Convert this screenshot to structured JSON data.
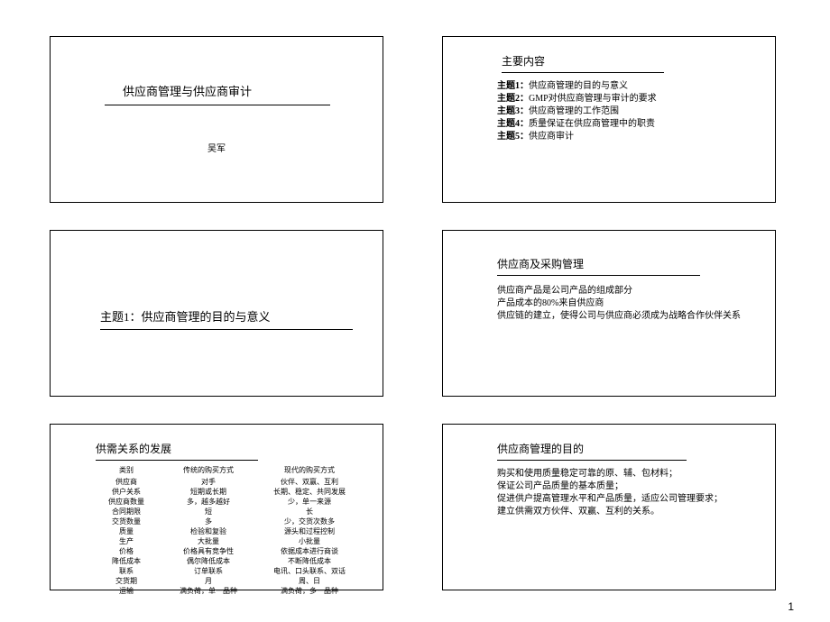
{
  "page_number": "1",
  "slide1": {
    "title": "供应商管理与供应商审计",
    "author": "吴军"
  },
  "slide2": {
    "title": "主要内容",
    "items": [
      {
        "prefix": "主题1：",
        "text": "供应商管理的目的与意义"
      },
      {
        "prefix": "主题2：",
        "text": "GMP对供应商管理与审计的要求"
      },
      {
        "prefix": "主题3：",
        "text": "供应商管理的工作范围"
      },
      {
        "prefix": "主题4：",
        "text": "质量保证在供应商管理中的职责"
      },
      {
        "prefix": "主题5：",
        "text": "供应商审计"
      }
    ]
  },
  "slide3": {
    "title": "主题1：供应商管理的目的与意义"
  },
  "slide4": {
    "title": "供应商及采购管理",
    "lines": [
      "供应商产品是公司产品的组成部分",
      "产品成本的80%来自供应商",
      "供应链的建立，使得公司与供应商必须成为战略合作伙伴关系"
    ]
  },
  "slide5": {
    "title": "供需关系的发展",
    "headers": [
      "类别",
      "传统的购买方式",
      "现代的购买方式"
    ],
    "rows": [
      [
        "供应商",
        "对手",
        "伙伴、双赢、互利"
      ],
      [
        "供户关系",
        "短期或长期",
        "长期、稳定、共同发展"
      ],
      [
        "供应商数量",
        "多，越多越好",
        "少，单一来源"
      ],
      [
        "合同期限",
        "短",
        "长"
      ],
      [
        "交货数量",
        "多",
        "少，交货次数多"
      ],
      [
        "质量",
        "检验和复验",
        "源头和过程控制"
      ],
      [
        "生产",
        "大批量",
        "小批量"
      ],
      [
        "价格",
        "价格具有竞争性",
        "依据成本进行商谈"
      ],
      [
        "降低成本",
        "偶尔降低成本",
        "不断降低成本"
      ],
      [
        "联系",
        "订单联系",
        "电讯、口头联系、双话"
      ],
      [
        "交货期",
        "月",
        "周、日"
      ],
      [
        "运输",
        "满负荷，单一品种",
        "满负荷，多一品种"
      ]
    ]
  },
  "slide6": {
    "title": "供应商管理的目的",
    "lines": [
      "购买和使用质量稳定可靠的原、辅、包材料；",
      "保证公司产品质量的基本质量；",
      "促进供户提高管理水平和产品质量，适应公司管理要求；",
      "建立供需双方伙伴、双赢、互利的关系。"
    ]
  }
}
